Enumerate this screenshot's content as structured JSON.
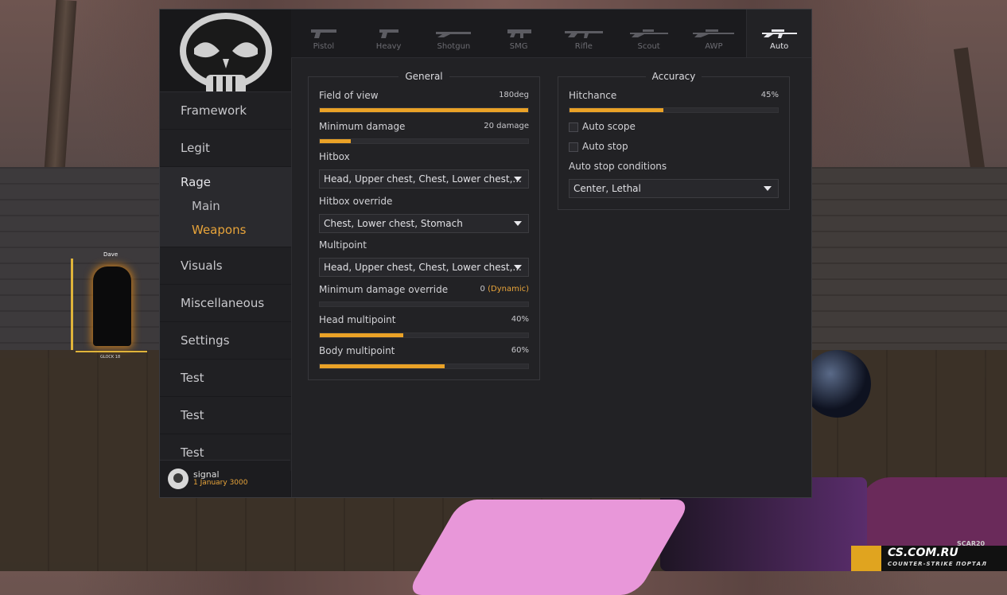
{
  "background": {
    "player_name": "Dave",
    "player_weapon": "GLOCK 18",
    "weapon_hud": "SCAR20",
    "watermark": {
      "site": "CS.COM.RU",
      "tagline": "COUNTER-STRIKE ПОРТАЛ"
    }
  },
  "sidebar": {
    "items": [
      {
        "label": "Framework"
      },
      {
        "label": "Legit"
      }
    ],
    "rage": {
      "label": "Rage",
      "subitems": [
        {
          "label": "Main"
        },
        {
          "label": "Weapons"
        }
      ]
    },
    "items_after": [
      {
        "label": "Visuals"
      },
      {
        "label": "Miscellaneous"
      },
      {
        "label": "Settings"
      },
      {
        "label": "Test"
      },
      {
        "label": "Test"
      },
      {
        "label": "Test"
      }
    ],
    "user": {
      "name": "signal",
      "date": "1 January 3000"
    }
  },
  "tabs": [
    {
      "label": "Pistol",
      "icon": "pistol-icon"
    },
    {
      "label": "Heavy",
      "icon": "heavy-pistol-icon"
    },
    {
      "label": "Shotgun",
      "icon": "shotgun-icon"
    },
    {
      "label": "SMG",
      "icon": "smg-icon"
    },
    {
      "label": "Rifle",
      "icon": "rifle-icon"
    },
    {
      "label": "Scout",
      "icon": "scout-icon"
    },
    {
      "label": "AWP",
      "icon": "awp-icon"
    },
    {
      "label": "Auto",
      "icon": "auto-sniper-icon",
      "active": true
    }
  ],
  "general": {
    "title": "General",
    "fov": {
      "label": "Field of view",
      "value": "180deg",
      "fraction": 1.0
    },
    "min_damage": {
      "label": "Minimum damage",
      "value": "20 damage",
      "fraction": 0.15
    },
    "hitbox": {
      "label": "Hitbox",
      "value": "Head, Upper chest, Chest, Lower chest,..."
    },
    "hitbox_override": {
      "label": "Hitbox override",
      "value": "Chest, Lower chest, Stomach"
    },
    "multipoint": {
      "label": "Multipoint",
      "value": "Head, Upper chest, Chest, Lower chest,..."
    },
    "min_damage_override": {
      "label": "Minimum damage override",
      "value": "0",
      "extra": "(Dynamic)",
      "fraction": 0.0
    },
    "head_multipoint": {
      "label": "Head multipoint",
      "value": "40%",
      "fraction": 0.4
    },
    "body_multipoint": {
      "label": "Body multipoint",
      "value": "60%",
      "fraction": 0.6
    }
  },
  "accuracy": {
    "title": "Accuracy",
    "hitchance": {
      "label": "Hitchance",
      "value": "45%",
      "fraction": 0.45
    },
    "auto_scope": {
      "label": "Auto scope",
      "checked": false
    },
    "auto_stop": {
      "label": "Auto stop",
      "checked": false
    },
    "auto_stop_conditions": {
      "label": "Auto stop conditions",
      "value": "Center, Lethal"
    }
  },
  "colors": {
    "accent": "#eaa227",
    "panel": "#222225",
    "sidebar": "#1a1a1d"
  }
}
